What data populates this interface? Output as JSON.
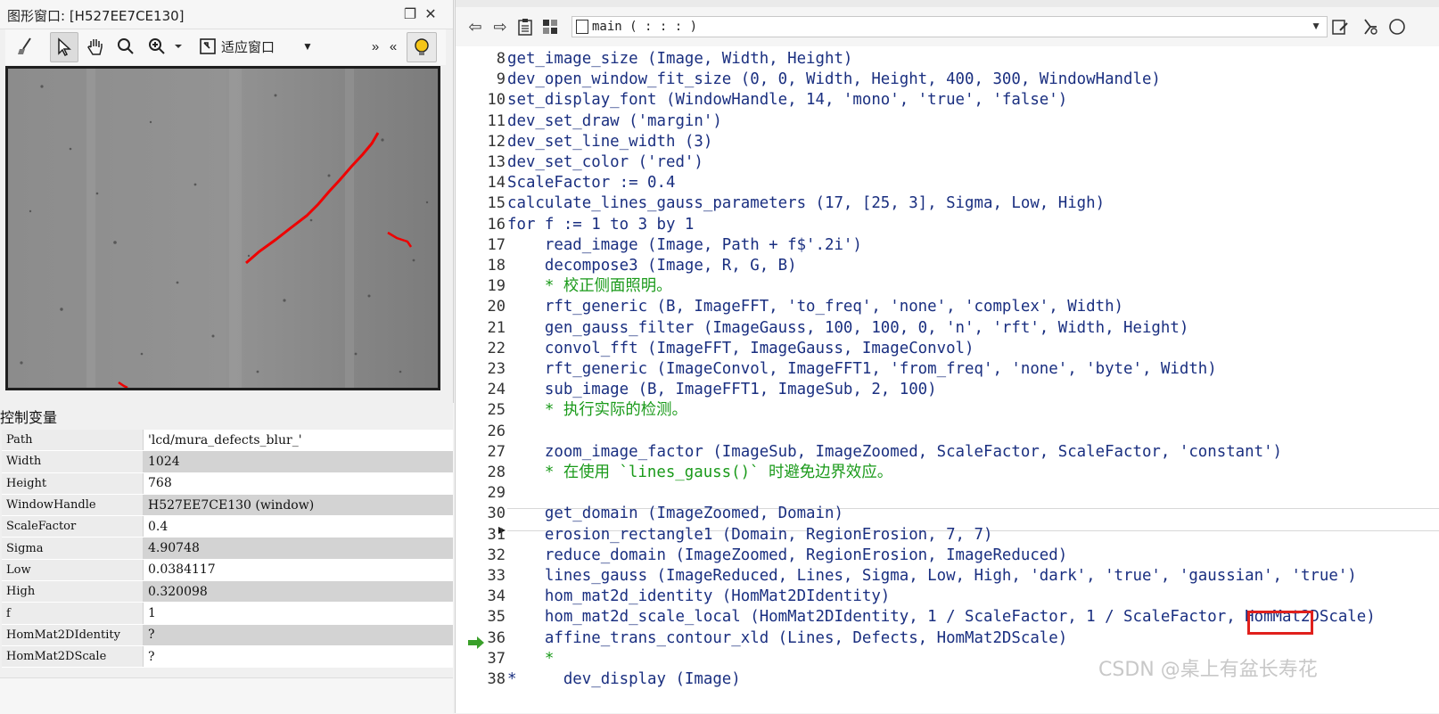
{
  "graphics_window": {
    "title": "图形窗口: [H527EE7CE130]",
    "toolbar": {
      "fit_label": "适应窗口",
      "more": "»",
      "collapse": "«"
    }
  },
  "control_variables": {
    "header": "控制变量",
    "rows": [
      {
        "name": "Path",
        "value": "'lcd/mura_defects_blur_'"
      },
      {
        "name": "Width",
        "value": "1024"
      },
      {
        "name": "Height",
        "value": "768"
      },
      {
        "name": "WindowHandle",
        "value": "H527EE7CE130 (window)"
      },
      {
        "name": "ScaleFactor",
        "value": "0.4"
      },
      {
        "name": "Sigma",
        "value": "4.90748"
      },
      {
        "name": "Low",
        "value": "0.0384117"
      },
      {
        "name": "High",
        "value": "0.320098"
      },
      {
        "name": "f",
        "value": "1"
      },
      {
        "name": "HomMat2DIdentity",
        "value": "?"
      },
      {
        "name": "HomMat2DScale",
        "value": "?"
      }
    ]
  },
  "program_window": {
    "procedure": "main ( : : : )",
    "lines": [
      {
        "n": "8",
        "t": "get_image_size (Image, Width, Height)",
        "k": "op"
      },
      {
        "n": "9",
        "t": "dev_open_window_fit_size (0, 0, Width, Height, 400, 300, WindowHandle)",
        "k": "op"
      },
      {
        "n": "10",
        "t": "set_display_font (WindowHandle, 14, 'mono', 'true', 'false')",
        "k": "op"
      },
      {
        "n": "11",
        "t": "dev_set_draw ('margin')",
        "k": "op"
      },
      {
        "n": "12",
        "t": "dev_set_line_width (3)",
        "k": "op"
      },
      {
        "n": "13",
        "t": "dev_set_color ('red')",
        "k": "op"
      },
      {
        "n": "14",
        "t": "ScaleFactor := 0.4",
        "k": "op"
      },
      {
        "n": "15",
        "t": "calculate_lines_gauss_parameters (17, [25, 3], Sigma, Low, High)",
        "k": "op"
      },
      {
        "n": "16",
        "t": "for f := 1 to 3 by 1",
        "k": "ctl"
      },
      {
        "n": "17",
        "t": "    read_image (Image, Path + f$'.2i')",
        "k": "op"
      },
      {
        "n": "18",
        "t": "    decompose3 (Image, R, G, B)",
        "k": "op"
      },
      {
        "n": "19",
        "t": "    * 校正侧面照明。",
        "k": "cm"
      },
      {
        "n": "20",
        "t": "    rft_generic (B, ImageFFT, 'to_freq', 'none', 'complex', Width)",
        "k": "op"
      },
      {
        "n": "21",
        "t": "    gen_gauss_filter (ImageGauss, 100, 100, 0, 'n', 'rft', Width, Height)",
        "k": "op"
      },
      {
        "n": "22",
        "t": "    convol_fft (ImageFFT, ImageGauss, ImageConvol)",
        "k": "op"
      },
      {
        "n": "23",
        "t": "    rft_generic (ImageConvol, ImageFFT1, 'from_freq', 'none', 'byte', Width)",
        "k": "op"
      },
      {
        "n": "24",
        "t": "    sub_image (B, ImageFFT1, ImageSub, 2, 100)",
        "k": "op"
      },
      {
        "n": "25",
        "t": "    * 执行实际的检测。",
        "k": "cm"
      },
      {
        "n": "26",
        "t": "",
        "k": "op"
      },
      {
        "n": "27",
        "t": "    zoom_image_factor (ImageSub, ImageZoomed, ScaleFactor, ScaleFactor, 'constant')",
        "k": "op"
      },
      {
        "n": "28",
        "t": "    * 在使用 `lines_gauss()` 时避免边界效应。",
        "k": "cm"
      },
      {
        "n": "29",
        "t": "",
        "k": "op"
      },
      {
        "n": "30",
        "t": "    get_domain (ImageZoomed, Domain)",
        "k": "op"
      },
      {
        "n": "31",
        "t": "    erosion_rectangle1 (Domain, RegionErosion, 7, 7)",
        "k": "op"
      },
      {
        "n": "32",
        "t": "    reduce_domain (ImageZoomed, RegionErosion, ImageReduced)",
        "k": "op"
      },
      {
        "n": "33",
        "t": "    lines_gauss (ImageReduced, Lines, Sigma, Low, High, 'dark', 'true', 'gaussian', 'true')",
        "k": "op"
      },
      {
        "n": "34",
        "t": "    hom_mat2d_identity (HomMat2DIdentity)",
        "k": "op"
      },
      {
        "n": "35",
        "t": "    hom_mat2d_scale_local (HomMat2DIdentity, 1 / ScaleFactor, 1 / ScaleFactor, HomMat2DScale)",
        "k": "op"
      },
      {
        "n": "36",
        "t": "    affine_trans_contour_xld (Lines, Defects, HomMat2DScale)",
        "k": "op"
      },
      {
        "n": "37",
        "t": "    *",
        "k": "cm"
      },
      {
        "n": "38",
        "t": "*     dev_display (Image)",
        "k": "op"
      }
    ]
  },
  "watermark": "CSDN @桌上有盆长寿花",
  "colors": {
    "accent_red": "#e0201c",
    "keyword": "#1f3a93",
    "comment": "#1a9a1a"
  }
}
